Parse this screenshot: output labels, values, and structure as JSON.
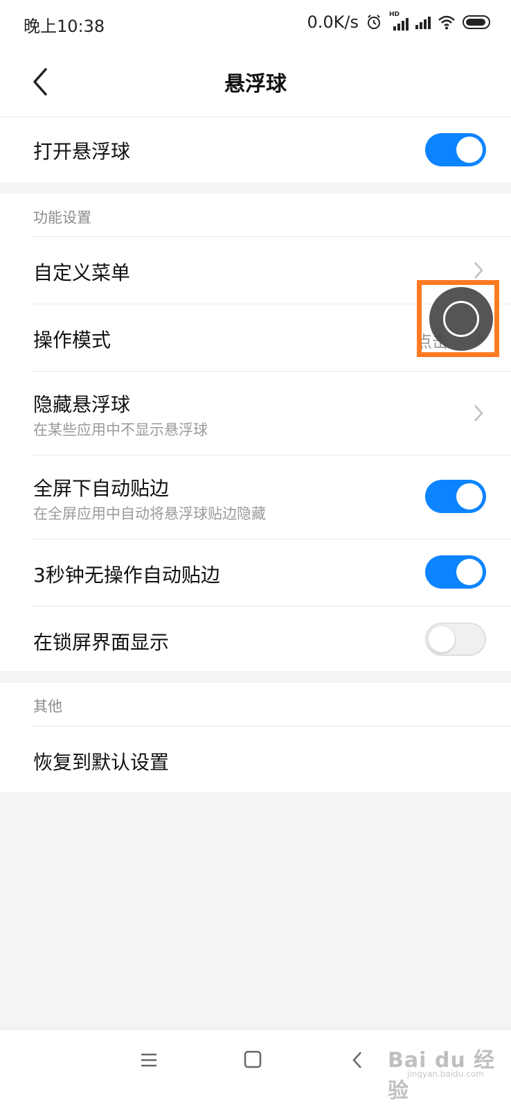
{
  "status_bar": {
    "time": "晚上10:38",
    "net_speed": "0.0K/s",
    "icons": [
      "alarm-icon",
      "hd-signal-icon",
      "signal-icon",
      "wifi-icon",
      "battery-icon"
    ],
    "hd_label": "HD"
  },
  "header": {
    "title": "悬浮球",
    "back_icon": "chevron-left-icon"
  },
  "main_toggle": {
    "label": "打开悬浮球",
    "on": true
  },
  "sections": {
    "function": {
      "heading": "功能设置",
      "custom_menu": {
        "label": "自定义菜单"
      },
      "operation_mode": {
        "label": "操作模式",
        "value": "点击"
      },
      "hide_ball": {
        "label": "隐藏悬浮球",
        "sub": "在某些应用中不显示悬浮球"
      },
      "auto_edge_fullscreen": {
        "label": "全屏下自动贴边",
        "sub": "在全屏应用中自动将悬浮球贴边隐藏",
        "on": true
      },
      "auto_edge_3s": {
        "label": "3秒钟无操作自动贴边",
        "on": true
      },
      "lockscreen": {
        "label": "在锁屏界面显示",
        "on": false
      }
    },
    "other": {
      "heading": "其他",
      "restore": {
        "label": "恢复到默认设置"
      }
    }
  },
  "nav_bar": {
    "icons": [
      "menu-icon",
      "home-icon",
      "back-icon"
    ]
  },
  "watermark": {
    "text": "Bai du 经验",
    "sub": "jingyan.baidu.com"
  },
  "colors": {
    "accent": "#0d84ff",
    "highlight": "#ff7a22"
  }
}
